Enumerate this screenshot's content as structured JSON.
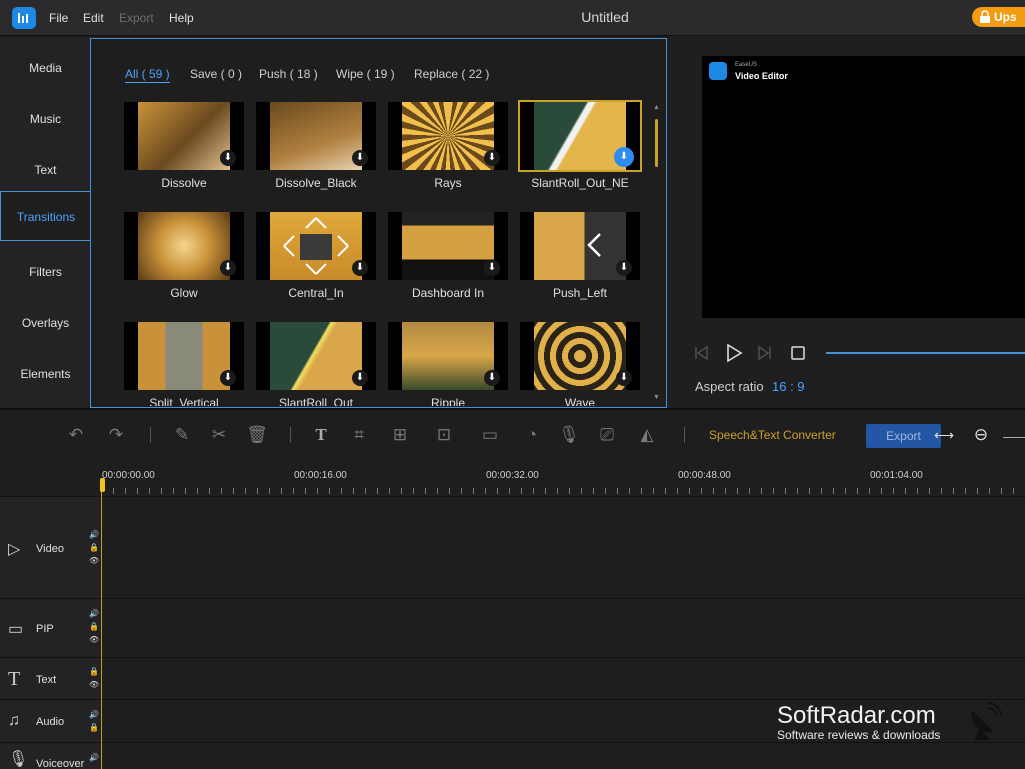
{
  "app": {
    "title": "Untitled",
    "upgrade_label": "Ups"
  },
  "menu": {
    "file": "File",
    "edit": "Edit",
    "export": "Export",
    "help": "Help"
  },
  "sidebar": {
    "items": [
      {
        "label": "Media"
      },
      {
        "label": "Music"
      },
      {
        "label": "Text"
      },
      {
        "label": "Transitions"
      },
      {
        "label": "Filters"
      },
      {
        "label": "Overlays"
      },
      {
        "label": "Elements"
      }
    ]
  },
  "library": {
    "filters": [
      "All ( 59 )",
      "Save ( 0 )",
      "Push ( 18 )",
      "Wipe ( 19 )",
      "Replace ( 22 )"
    ],
    "items": [
      {
        "label": "Dissolve"
      },
      {
        "label": "Dissolve_Black"
      },
      {
        "label": "Rays"
      },
      {
        "label": "SlantRoll_Out_NE"
      },
      {
        "label": "Glow"
      },
      {
        "label": "Central_In"
      },
      {
        "label": "Dashboard In"
      },
      {
        "label": "Push_Left"
      },
      {
        "label": "Split_Vertical"
      },
      {
        "label": "SlantRoll_Out"
      },
      {
        "label": "Ripple"
      },
      {
        "label": "Wave"
      }
    ]
  },
  "preview": {
    "brand_small": "EaseUS",
    "brand_name": "Video Editor",
    "aspect_label": "Aspect ratio",
    "aspect_value": "16 : 9"
  },
  "toolbar": {
    "speech_label": "Speech&Text Converter",
    "export_label": "Export"
  },
  "ruler": {
    "ticks": [
      "00:00:00.00",
      "00:00:16.00",
      "00:00:32.00",
      "00:00:48.00",
      "00:01:04.00"
    ]
  },
  "tracks": [
    {
      "label": "Video"
    },
    {
      "label": "PIP"
    },
    {
      "label": "Text"
    },
    {
      "label": "Audio"
    },
    {
      "label": "Voiceover"
    }
  ],
  "watermark": {
    "title": "SoftRadar.com",
    "subtitle": "Software reviews & downloads"
  },
  "colors": {
    "accent": "#4aa3ff",
    "gold": "#c8a227",
    "upgrade": "#f39c12"
  }
}
